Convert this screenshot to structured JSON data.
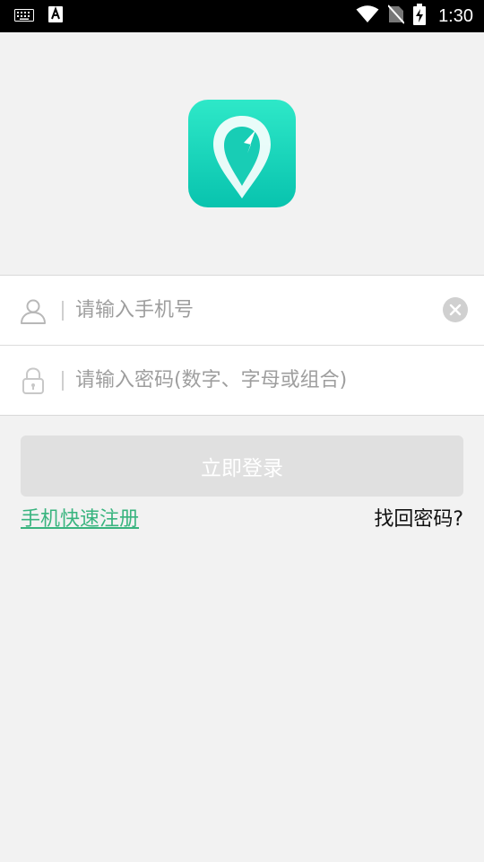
{
  "status_bar": {
    "time": "1:30",
    "icons": [
      "keyboard-icon",
      "text-a-icon",
      "wifi-icon",
      "no-sim-icon",
      "battery-charging-icon"
    ]
  },
  "app": {
    "logo_icon": "location-pin-logo-icon",
    "brand_color": "#0fd3b8"
  },
  "form": {
    "phone": {
      "placeholder": "请输入手机号",
      "value": "",
      "icon": "user-icon",
      "clear_icon": "clear-icon"
    },
    "password": {
      "placeholder": "请输入密码(数字、字母或组合)",
      "value": "",
      "icon": "lock-icon"
    }
  },
  "actions": {
    "login_label": "立即登录",
    "register_label": "手机快速注册",
    "forgot_label": "找回密码?"
  },
  "colors": {
    "link_green": "#39b47f",
    "button_disabled": "#e0e0e0",
    "background": "#f2f2f2"
  }
}
